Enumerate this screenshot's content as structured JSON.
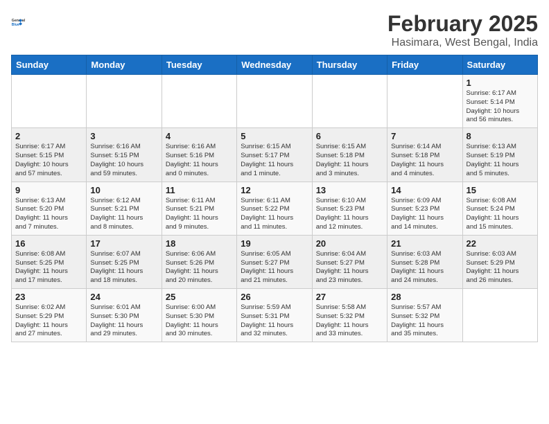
{
  "header": {
    "logo_line1": "General",
    "logo_line2": "Blue",
    "title": "February 2025",
    "subtitle": "Hasimara, West Bengal, India"
  },
  "weekdays": [
    "Sunday",
    "Monday",
    "Tuesday",
    "Wednesday",
    "Thursday",
    "Friday",
    "Saturday"
  ],
  "weeks": [
    [
      {
        "day": "",
        "info": ""
      },
      {
        "day": "",
        "info": ""
      },
      {
        "day": "",
        "info": ""
      },
      {
        "day": "",
        "info": ""
      },
      {
        "day": "",
        "info": ""
      },
      {
        "day": "",
        "info": ""
      },
      {
        "day": "1",
        "info": "Sunrise: 6:17 AM\nSunset: 5:14 PM\nDaylight: 10 hours\nand 56 minutes."
      }
    ],
    [
      {
        "day": "2",
        "info": "Sunrise: 6:17 AM\nSunset: 5:15 PM\nDaylight: 10 hours\nand 57 minutes."
      },
      {
        "day": "3",
        "info": "Sunrise: 6:16 AM\nSunset: 5:15 PM\nDaylight: 10 hours\nand 59 minutes."
      },
      {
        "day": "4",
        "info": "Sunrise: 6:16 AM\nSunset: 5:16 PM\nDaylight: 11 hours\nand 0 minutes."
      },
      {
        "day": "5",
        "info": "Sunrise: 6:15 AM\nSunset: 5:17 PM\nDaylight: 11 hours\nand 1 minute."
      },
      {
        "day": "6",
        "info": "Sunrise: 6:15 AM\nSunset: 5:18 PM\nDaylight: 11 hours\nand 3 minutes."
      },
      {
        "day": "7",
        "info": "Sunrise: 6:14 AM\nSunset: 5:18 PM\nDaylight: 11 hours\nand 4 minutes."
      },
      {
        "day": "8",
        "info": "Sunrise: 6:13 AM\nSunset: 5:19 PM\nDaylight: 11 hours\nand 5 minutes."
      }
    ],
    [
      {
        "day": "9",
        "info": "Sunrise: 6:13 AM\nSunset: 5:20 PM\nDaylight: 11 hours\nand 7 minutes."
      },
      {
        "day": "10",
        "info": "Sunrise: 6:12 AM\nSunset: 5:21 PM\nDaylight: 11 hours\nand 8 minutes."
      },
      {
        "day": "11",
        "info": "Sunrise: 6:11 AM\nSunset: 5:21 PM\nDaylight: 11 hours\nand 9 minutes."
      },
      {
        "day": "12",
        "info": "Sunrise: 6:11 AM\nSunset: 5:22 PM\nDaylight: 11 hours\nand 11 minutes."
      },
      {
        "day": "13",
        "info": "Sunrise: 6:10 AM\nSunset: 5:23 PM\nDaylight: 11 hours\nand 12 minutes."
      },
      {
        "day": "14",
        "info": "Sunrise: 6:09 AM\nSunset: 5:23 PM\nDaylight: 11 hours\nand 14 minutes."
      },
      {
        "day": "15",
        "info": "Sunrise: 6:08 AM\nSunset: 5:24 PM\nDaylight: 11 hours\nand 15 minutes."
      }
    ],
    [
      {
        "day": "16",
        "info": "Sunrise: 6:08 AM\nSunset: 5:25 PM\nDaylight: 11 hours\nand 17 minutes."
      },
      {
        "day": "17",
        "info": "Sunrise: 6:07 AM\nSunset: 5:25 PM\nDaylight: 11 hours\nand 18 minutes."
      },
      {
        "day": "18",
        "info": "Sunrise: 6:06 AM\nSunset: 5:26 PM\nDaylight: 11 hours\nand 20 minutes."
      },
      {
        "day": "19",
        "info": "Sunrise: 6:05 AM\nSunset: 5:27 PM\nDaylight: 11 hours\nand 21 minutes."
      },
      {
        "day": "20",
        "info": "Sunrise: 6:04 AM\nSunset: 5:27 PM\nDaylight: 11 hours\nand 23 minutes."
      },
      {
        "day": "21",
        "info": "Sunrise: 6:03 AM\nSunset: 5:28 PM\nDaylight: 11 hours\nand 24 minutes."
      },
      {
        "day": "22",
        "info": "Sunrise: 6:03 AM\nSunset: 5:29 PM\nDaylight: 11 hours\nand 26 minutes."
      }
    ],
    [
      {
        "day": "23",
        "info": "Sunrise: 6:02 AM\nSunset: 5:29 PM\nDaylight: 11 hours\nand 27 minutes."
      },
      {
        "day": "24",
        "info": "Sunrise: 6:01 AM\nSunset: 5:30 PM\nDaylight: 11 hours\nand 29 minutes."
      },
      {
        "day": "25",
        "info": "Sunrise: 6:00 AM\nSunset: 5:30 PM\nDaylight: 11 hours\nand 30 minutes."
      },
      {
        "day": "26",
        "info": "Sunrise: 5:59 AM\nSunset: 5:31 PM\nDaylight: 11 hours\nand 32 minutes."
      },
      {
        "day": "27",
        "info": "Sunrise: 5:58 AM\nSunset: 5:32 PM\nDaylight: 11 hours\nand 33 minutes."
      },
      {
        "day": "28",
        "info": "Sunrise: 5:57 AM\nSunset: 5:32 PM\nDaylight: 11 hours\nand 35 minutes."
      },
      {
        "day": "",
        "info": ""
      }
    ]
  ]
}
